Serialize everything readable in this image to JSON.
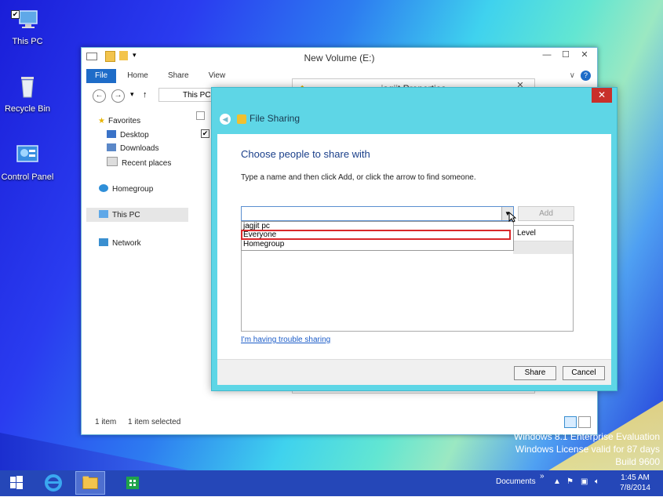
{
  "desktop": {
    "icons": [
      {
        "label": "This PC",
        "checked": true
      },
      {
        "label": "Recycle Bin"
      },
      {
        "label": "Control Panel"
      }
    ],
    "watermark": [
      "Windows 8.1 Enterprise Evaluation",
      "Windows License valid for 87 days",
      "Build 9600"
    ]
  },
  "explorer": {
    "title": "New Volume (E:)",
    "ribbon_tabs": [
      "File",
      "Home",
      "Share",
      "View"
    ],
    "address": "This PC",
    "nav": {
      "favorites": "Favorites",
      "desktop": "Desktop",
      "downloads": "Downloads",
      "recent": "Recent places",
      "homegroup": "Homegroup",
      "this_pc": "This PC",
      "network": "Network"
    },
    "status": {
      "items": "1 item",
      "selected": "1 item selected"
    }
  },
  "properties": {
    "title": "jagjit Properties"
  },
  "file_sharing": {
    "title": "File Sharing",
    "heading": "Choose people to share with",
    "instruction": "Type a name and then click Add, or click the arrow to find someone.",
    "combo_value": "",
    "add_label": "Add",
    "column_level": "Level",
    "options": [
      "jagjit pc",
      "Everyone",
      "Homegroup"
    ],
    "highlighted_option": "Everyone",
    "trouble_link": "I'm having trouble sharing",
    "share_label": "Share",
    "cancel_label": "Cancel"
  },
  "taskbar": {
    "toolbar_label": "Documents",
    "time": "1:45 AM",
    "date": "7/8/2014"
  },
  "colors": {
    "accent": "#1e6cc8",
    "dialog_frame": "#5ed6e6",
    "close": "#c8302b",
    "highlight": "#d9282a",
    "taskbar": "#2547b8"
  }
}
